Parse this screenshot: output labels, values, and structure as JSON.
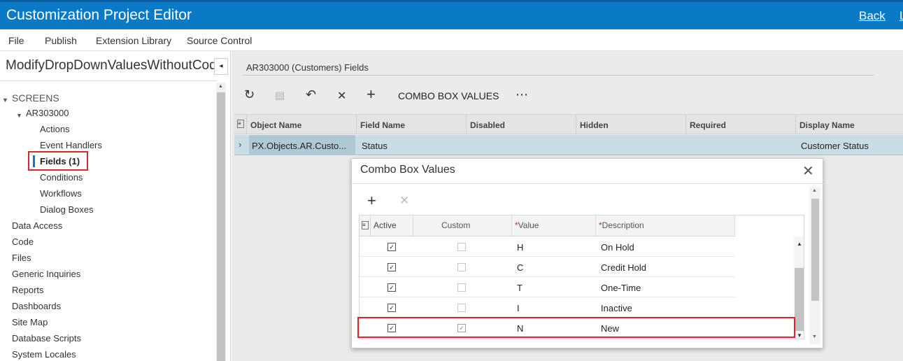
{
  "window": {
    "title": "Customization Project Editor",
    "back_link": "Back",
    "extra_link": "L"
  },
  "menu": [
    "File",
    "Publish",
    "Extension Library",
    "Source Control"
  ],
  "project": {
    "name": "ModifyDropDownValuesWithoutCode",
    "collapse_icon": "◂"
  },
  "tree": {
    "screens": "SCREENS",
    "screen_id": "AR303000",
    "children": [
      "Actions",
      "Event Handlers",
      "Fields (1)",
      "Conditions",
      "Workflows",
      "Dialog Boxes"
    ],
    "sections": [
      "Data Access",
      "Code",
      "Files",
      "Generic Inquiries",
      "Reports",
      "Dashboards",
      "Site Map",
      "Database Scripts",
      "System Locales"
    ]
  },
  "main": {
    "heading": "AR303000 (Customers) Fields",
    "toolbar": {
      "refresh_icon": "↻",
      "save_icon": "▤",
      "undo_icon": "↶",
      "delete_icon": "✕",
      "add_icon": "+",
      "combo_box_values": "COMBO BOX VALUES",
      "more_icon": "⋯"
    },
    "grid": {
      "columns": [
        "Object Name",
        "Field Name",
        "Disabled",
        "Hidden",
        "Required",
        "Display Name"
      ],
      "row": {
        "object_name": "PX.Objects.AR.Custo...",
        "field_name": "Status",
        "display_name": "Customer Status"
      }
    }
  },
  "dialog": {
    "title": "Combo Box Values",
    "close_icon": "✕",
    "add_icon": "+",
    "delete_icon": "✕",
    "columns": {
      "active": "Active",
      "custom": "Custom",
      "value": "Value",
      "description": "Description",
      "required_mark": "*"
    },
    "rows": [
      {
        "active": true,
        "custom": false,
        "value": "H",
        "description": "On Hold"
      },
      {
        "active": true,
        "custom": false,
        "value": "C",
        "description": "Credit Hold"
      },
      {
        "active": true,
        "custom": false,
        "value": "T",
        "description": "One-Time"
      },
      {
        "active": true,
        "custom": false,
        "value": "I",
        "description": "Inactive"
      },
      {
        "active": true,
        "custom": true,
        "value": "N",
        "description": "New"
      }
    ]
  }
}
